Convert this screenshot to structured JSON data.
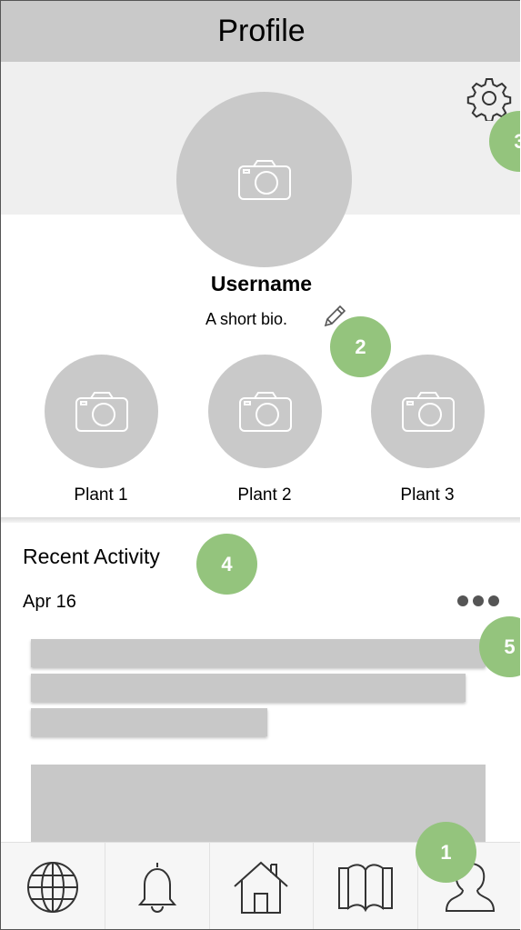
{
  "header": {
    "title": "Profile"
  },
  "profile": {
    "username": "Username",
    "bio": "A short bio."
  },
  "plants": [
    {
      "label": "Plant 1"
    },
    {
      "label": "Plant 2"
    },
    {
      "label": "Plant 3"
    }
  ],
  "activity": {
    "title": "Recent Activity",
    "date": "Apr 16"
  },
  "annotations": [
    "1",
    "2",
    "3",
    "4",
    "5"
  ],
  "nav": [
    "globe-icon",
    "bell-icon",
    "home-icon",
    "book-icon",
    "user-icon"
  ],
  "colors": {
    "header_bg": "#c9c9c9",
    "hero_bg": "#efefef",
    "placeholder": "#c9c9c9",
    "badge": "#94c47d"
  }
}
